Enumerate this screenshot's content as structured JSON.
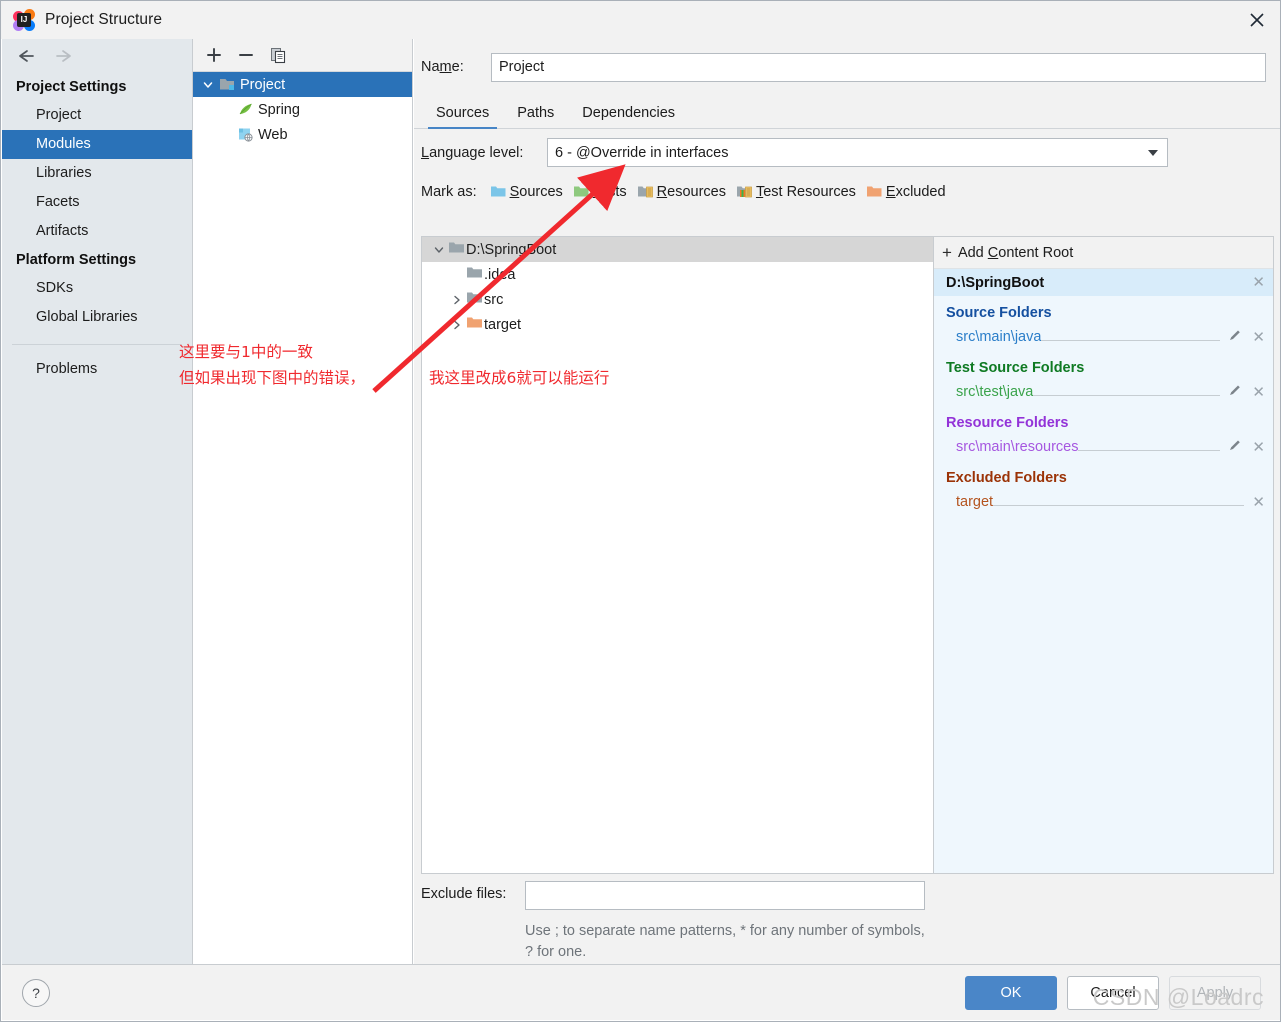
{
  "window": {
    "title": "Project Structure",
    "logo_text": "IJ",
    "close_icon": "close-icon"
  },
  "nav": {
    "back_icon": "arrow-left-icon",
    "forward_icon": "arrow-right-icon"
  },
  "sidebar": {
    "groups": [
      {
        "title": "Project Settings",
        "items": [
          {
            "label": "Project",
            "selected": false
          },
          {
            "label": "Modules",
            "selected": true
          },
          {
            "label": "Libraries",
            "selected": false
          },
          {
            "label": "Facets",
            "selected": false
          },
          {
            "label": "Artifacts",
            "selected": false
          }
        ]
      },
      {
        "title": "Platform Settings",
        "items": [
          {
            "label": "SDKs",
            "selected": false
          },
          {
            "label": "Global Libraries",
            "selected": false
          }
        ]
      }
    ],
    "problems_label": "Problems"
  },
  "module_tree": {
    "toolbar": [
      {
        "name": "add-module-button",
        "glyph": "+"
      },
      {
        "name": "remove-module-button",
        "glyph": "−"
      },
      {
        "name": "copy-module-button",
        "glyph": "copy-icon"
      }
    ],
    "rows": [
      {
        "label": "Project",
        "indent": 0,
        "twisty": "expanded",
        "icon": "module-folder-icon",
        "selected": true
      },
      {
        "label": "Spring",
        "indent": 1,
        "twisty": "none",
        "icon": "spring-leaf-icon",
        "selected": false
      },
      {
        "label": "Web",
        "indent": 1,
        "twisty": "none",
        "icon": "web-facet-icon",
        "selected": false
      }
    ]
  },
  "main": {
    "name_label_pre": "Na",
    "name_label_mnemonic": "m",
    "name_label_post": "e:",
    "name_value": "Project",
    "name_placeholder": "",
    "tabs": [
      {
        "label": "Sources",
        "active": true
      },
      {
        "label": "Paths",
        "active": false
      },
      {
        "label": "Dependencies",
        "active": false
      }
    ],
    "language_level_label_mnemonic": "L",
    "language_level_label_rest": "anguage level:",
    "language_level_value": "6 - @Override in interfaces",
    "mark_as_label": "Mark as:",
    "mark_as_items": [
      {
        "pre": "",
        "mnemonic": "S",
        "post": "ources",
        "icon": "sources-folder-icon",
        "color": "#7bc5e8"
      },
      {
        "pre": "",
        "mnemonic": "T",
        "post": "ests",
        "icon": "tests-folder-icon",
        "color": "#8ec97e"
      },
      {
        "pre": "",
        "mnemonic": "R",
        "post": "esources",
        "icon": "resources-folder-icon",
        "color": "#9aa5ac"
      },
      {
        "pre": "",
        "mnemonic": "T",
        "post": "est Resources",
        "icon": "test-resources-folder-icon",
        "color": "#9aa5ac"
      },
      {
        "pre": "",
        "mnemonic": "E",
        "post": "xcluded",
        "icon": "excluded-folder-icon",
        "color": "#f0a271"
      }
    ],
    "content_tree": [
      {
        "label": "D:\\SpringBoot",
        "indent": 0,
        "twisty": "expanded",
        "color": "#9aa5ac",
        "selected": true
      },
      {
        "label": ".idea",
        "indent": 1,
        "twisty": "none",
        "color": "#9aa5ac",
        "selected": false
      },
      {
        "label": "src",
        "indent": 1,
        "twisty": "collapsed",
        "color": "#9aa5ac",
        "selected": false
      },
      {
        "label": "target",
        "indent": 1,
        "twisty": "collapsed",
        "color": "#f0a271",
        "selected": false
      }
    ],
    "exclude_files_label": "Exclude files:",
    "exclude_files_value": "",
    "exclude_files_hint": "Use ; to separate name patterns, * for any number of symbols, ? for one."
  },
  "content_roots": {
    "add_button_pre": "Add ",
    "add_button_mnemonic": "C",
    "add_button_post": "ontent Root",
    "root_path": "D:\\SpringBoot",
    "groups": [
      {
        "title": "Source Folders",
        "color": "#1550a0",
        "entry_color": "#2b7ec9",
        "entries": [
          {
            "path": "src\\main\\java",
            "has_edit": true
          }
        ]
      },
      {
        "title": "Test Source Folders",
        "color": "#0f7a23",
        "entry_color": "#3aa34b",
        "entries": [
          {
            "path": "src\\test\\java",
            "has_edit": true
          }
        ]
      },
      {
        "title": "Resource Folders",
        "color": "#9333d8",
        "entry_color": "#a657e0",
        "entries": [
          {
            "path": "src\\main\\resources",
            "has_edit": true
          }
        ]
      },
      {
        "title": "Excluded Folders",
        "color": "#9b3307",
        "entry_color": "#b4541f",
        "entries": [
          {
            "path": "target",
            "has_edit": false
          }
        ]
      }
    ]
  },
  "footer": {
    "help_glyph": "?",
    "ok_label": "OK",
    "cancel_label": "Cancel",
    "apply_label": "Apply"
  },
  "annotations": {
    "line1": "这里要与1中的一致",
    "line2": "但如果出现下图中的错误，",
    "line3": "我这里改成6就可以能运行",
    "arrow_color": "#f0292e"
  },
  "watermark": "CSDN @Loadrc"
}
